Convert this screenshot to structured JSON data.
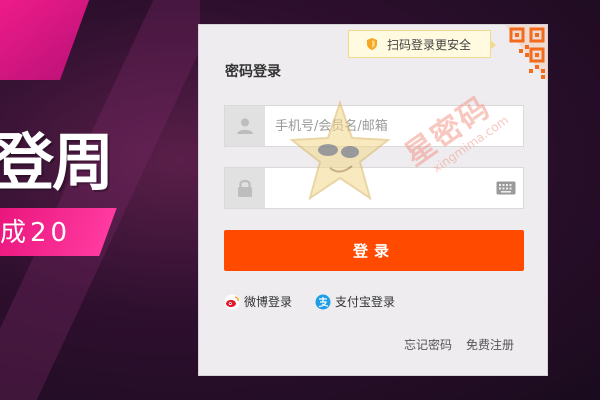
{
  "banner": {
    "headline": "登周",
    "subtext": "成20"
  },
  "login": {
    "qr_tip": "扫码登录更安全",
    "title": "密码登录",
    "username_placeholder": "手机号/会员名/邮箱",
    "password_placeholder": "",
    "submit_label": "登录",
    "weibo_label": "微博登录",
    "alipay_label": "支付宝登录",
    "forgot_label": "忘记密码",
    "register_label": "免费注册"
  },
  "watermark": {
    "brand": "星密码",
    "url": "xingmima.com"
  },
  "colors": {
    "accent": "#ff4a00",
    "panel_bg": "#eeecef",
    "tip_bg": "#fffae0",
    "banner_magenta": "#ff1f8f"
  },
  "icons": {
    "user": "user-icon",
    "lock": "lock-icon",
    "keyboard": "keyboard-icon",
    "shield": "shield-icon",
    "qr": "qr-code-icon",
    "weibo": "weibo-icon",
    "alipay": "alipay-icon"
  }
}
